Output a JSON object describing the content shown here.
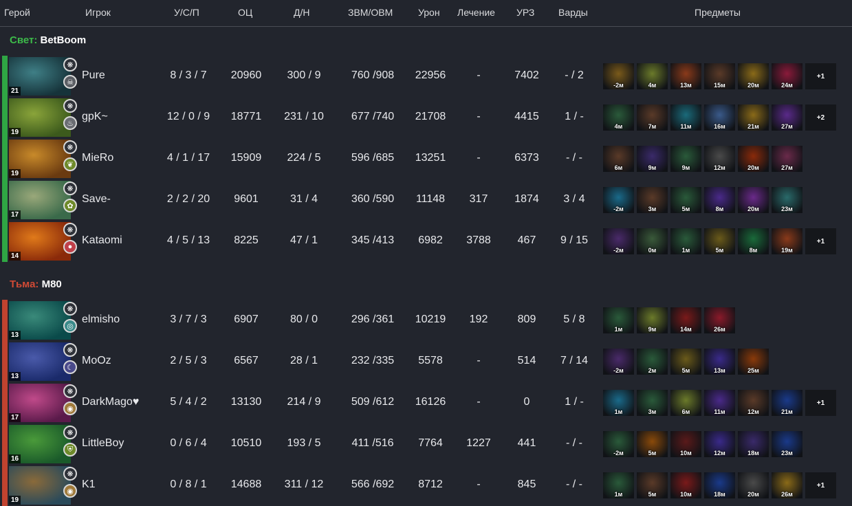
{
  "headers": {
    "hero": "Герой",
    "player": "Игрок",
    "kda": "У/С/П",
    "networth": "ОЦ",
    "lh_dn": "Д/Н",
    "gpm_xpm": "ЗВМ/ОВМ",
    "damage": "Урон",
    "healing": "Лечение",
    "building_damage": "УРЗ",
    "wards": "Варды",
    "items": "Предметы"
  },
  "teams": [
    {
      "side_label": "Свет:",
      "team_name": "BetBoom",
      "side_color": "#3dbb4a",
      "players": [
        {
          "player": "Pure",
          "level": "21",
          "kda": "8 / 3 / 7",
          "networth": "20960",
          "lh_dn": "300 / 9",
          "gpm_xpm": "760 /908",
          "damage": "22956",
          "healing": "-",
          "building_damage": "7402",
          "wards": "- / 2",
          "hero_colors": [
            "#16333a",
            "#3f7f86"
          ],
          "facet_color": "#5a5d63",
          "facet_icon": "skull-icon",
          "items": [
            {
              "time": "-2м",
              "c": "#7a5a1a"
            },
            {
              "time": "4м",
              "c": "#6b7a2a"
            },
            {
              "time": "13м",
              "c": "#8a3a1a"
            },
            {
              "time": "15м",
              "c": "#5a3a28"
            },
            {
              "time": "20м",
              "c": "#8a6a18"
            },
            {
              "time": "24м",
              "c": "#8a1a3a"
            }
          ],
          "more": "+1"
        },
        {
          "player": "gpK~",
          "level": "19",
          "kda": "12 / 0 / 9",
          "networth": "18771",
          "lh_dn": "231 / 10",
          "gpm_xpm": "677 /740",
          "damage": "21708",
          "healing": "-",
          "building_damage": "4415",
          "wards": "1 / -",
          "hero_colors": [
            "#3c5a1c",
            "#8aa43a"
          ],
          "facet_color": "#6a6d73",
          "facet_icon": "flame-icon",
          "items": [
            {
              "time": "4м",
              "c": "#2a5a3a"
            },
            {
              "time": "7м",
              "c": "#5a3a28"
            },
            {
              "time": "11м",
              "c": "#1a6a7a"
            },
            {
              "time": "16м",
              "c": "#3a5a8a"
            },
            {
              "time": "21м",
              "c": "#8a6a18"
            },
            {
              "time": "27м",
              "c": "#5a2a8a"
            }
          ],
          "more": "+2"
        },
        {
          "player": "MieRo",
          "level": "19",
          "kda": "4 / 1 / 17",
          "networth": "15909",
          "lh_dn": "224 / 5",
          "gpm_xpm": "596 /685",
          "damage": "13251",
          "healing": "-",
          "building_damage": "6373",
          "wards": "- / -",
          "hero_colors": [
            "#6a3a10",
            "#c88a2a"
          ],
          "facet_color": "#6e8a2a",
          "facet_icon": "leaf-icon",
          "items": [
            {
              "time": "6м",
              "c": "#5a3a28"
            },
            {
              "time": "9м",
              "c": "#3a2a6a"
            },
            {
              "time": "9м",
              "c": "#2a5a3a"
            },
            {
              "time": "12м",
              "c": "#4a4a4a"
            },
            {
              "time": "20м",
              "c": "#8a2a0a"
            },
            {
              "time": "27м",
              "c": "#6a2a4a"
            }
          ],
          "more": ""
        },
        {
          "player": "Save-",
          "level": "17",
          "kda": "2 / 2 / 20",
          "networth": "9601",
          "lh_dn": "31 / 4",
          "gpm_xpm": "360 /590",
          "damage": "11148",
          "healing": "317",
          "building_damage": "1874",
          "wards": "3 / 4",
          "hero_colors": [
            "#3a6a4a",
            "#9aa87a"
          ],
          "facet_color": "#6e8a2a",
          "facet_icon": "vine-icon",
          "items": [
            {
              "time": "-2м",
              "c": "#1a6a8a"
            },
            {
              "time": "3м",
              "c": "#5a3a28"
            },
            {
              "time": "5м",
              "c": "#2a5a3a"
            },
            {
              "time": "8м",
              "c": "#4a2a8a"
            },
            {
              "time": "20м",
              "c": "#6a2a8a"
            },
            {
              "time": "23м",
              "c": "#2a6a6a"
            }
          ],
          "more": ""
        },
        {
          "player": "Kataomi",
          "level": "14",
          "kda": "4 / 5 / 13",
          "networth": "8225",
          "lh_dn": "47 / 1",
          "gpm_xpm": "345 /413",
          "damage": "6982",
          "healing": "3788",
          "building_damage": "467",
          "wards": "9 / 15",
          "hero_colors": [
            "#8a2a0a",
            "#e07a1a"
          ],
          "facet_color": "#c0404a",
          "facet_icon": "drop-icon",
          "items": [
            {
              "time": "-2м",
              "c": "#4a2a6a"
            },
            {
              "time": "0м",
              "c": "#3a5a3a"
            },
            {
              "time": "1м",
              "c": "#2a5a3a"
            },
            {
              "time": "5м",
              "c": "#6a5a1a"
            },
            {
              "time": "8м",
              "c": "#1a6a3a"
            },
            {
              "time": "19м",
              "c": "#8a3a1a"
            }
          ],
          "more": "+1"
        }
      ]
    },
    {
      "side_label": "Тьма:",
      "team_name": "M80",
      "side_color": "#d04a35",
      "players": [
        {
          "player": "elmisho",
          "level": "13",
          "kda": "3 / 7 / 3",
          "networth": "6907",
          "lh_dn": "80 / 0",
          "gpm_xpm": "296 /361",
          "damage": "10219",
          "healing": "192",
          "building_damage": "809",
          "wards": "5 / 8",
          "hero_colors": [
            "#0a4a4a",
            "#3a8a7a"
          ],
          "facet_color": "#3a8a8a",
          "facet_icon": "spiral-icon",
          "items": [
            {
              "time": "1м",
              "c": "#2a5a3a"
            },
            {
              "time": "9м",
              "c": "#6b7a2a"
            },
            {
              "time": "14м",
              "c": "#7a1a1a"
            },
            {
              "time": "26м",
              "c": "#8a1a2a"
            }
          ],
          "more": ""
        },
        {
          "player": "MoOz",
          "level": "13",
          "kda": "2 / 5 / 3",
          "networth": "6567",
          "lh_dn": "28 / 1",
          "gpm_xpm": "232 /335",
          "damage": "5578",
          "healing": "-",
          "building_damage": "514",
          "wards": "7 / 14",
          "hero_colors": [
            "#1a2a6a",
            "#4a5aaa"
          ],
          "facet_color": "#4a4a8a",
          "facet_icon": "moon-icon",
          "items": [
            {
              "time": "-2м",
              "c": "#4a2a6a"
            },
            {
              "time": "2м",
              "c": "#2a5a3a"
            },
            {
              "time": "5м",
              "c": "#6a5a1a"
            },
            {
              "time": "13м",
              "c": "#3a2a8a"
            },
            {
              "time": "25м",
              "c": "#8a3a0a"
            }
          ],
          "more": ""
        },
        {
          "player": "DarkMago♥",
          "level": "17",
          "kda": "5 / 4 / 2",
          "networth": "13130",
          "lh_dn": "214 / 9",
          "gpm_xpm": "509 /612",
          "damage": "16126",
          "healing": "-",
          "building_damage": "0",
          "wards": "1 / -",
          "hero_colors": [
            "#5a1a4a",
            "#c04a8a"
          ],
          "facet_color": "#a07a3a",
          "facet_icon": "coin-icon",
          "items": [
            {
              "time": "1м",
              "c": "#1a6a8a"
            },
            {
              "time": "3м",
              "c": "#2a5a3a"
            },
            {
              "time": "6м",
              "c": "#6b7a2a"
            },
            {
              "time": "11м",
              "c": "#4a2a8a"
            },
            {
              "time": "12м",
              "c": "#5a3a28"
            },
            {
              "time": "21м",
              "c": "#1a3a8a"
            }
          ],
          "more": "+1"
        },
        {
          "player": "LittleBoy",
          "level": "16",
          "kda": "0 / 6 / 4",
          "networth": "10510",
          "lh_dn": "193 / 5",
          "gpm_xpm": "411 /516",
          "damage": "7764",
          "healing": "1227",
          "building_damage": "441",
          "wards": "- / -",
          "hero_colors": [
            "#1a5a2a",
            "#4a9a3a"
          ],
          "facet_color": "#6e8a2a",
          "facet_icon": "shield-icon",
          "items": [
            {
              "time": "-2м",
              "c": "#2a5a3a"
            },
            {
              "time": "5м",
              "c": "#8a4a0a"
            },
            {
              "time": "10м",
              "c": "#5a1a1a"
            },
            {
              "time": "12м",
              "c": "#3a2a8a"
            },
            {
              "time": "18м",
              "c": "#3a2a6a"
            },
            {
              "time": "23м",
              "c": "#1a3a8a"
            }
          ],
          "more": ""
        },
        {
          "player": "K1",
          "level": "19",
          "kda": "0 / 8 / 1",
          "networth": "14688",
          "lh_dn": "311 / 12",
          "gpm_xpm": "566 /692",
          "damage": "8712",
          "healing": "-",
          "building_damage": "845",
          "wards": "- / -",
          "hero_colors": [
            "#2a4a5a",
            "#8a6a3a"
          ],
          "facet_color": "#a07a3a",
          "facet_icon": "coin-icon",
          "items": [
            {
              "time": "1м",
              "c": "#2a5a3a"
            },
            {
              "time": "5м",
              "c": "#5a3a28"
            },
            {
              "time": "10м",
              "c": "#7a1a1a"
            },
            {
              "time": "18м",
              "c": "#1a3a8a"
            },
            {
              "time": "20м",
              "c": "#4a4a4a"
            },
            {
              "time": "26м",
              "c": "#8a6a18"
            }
          ],
          "more": "+1"
        }
      ]
    }
  ]
}
